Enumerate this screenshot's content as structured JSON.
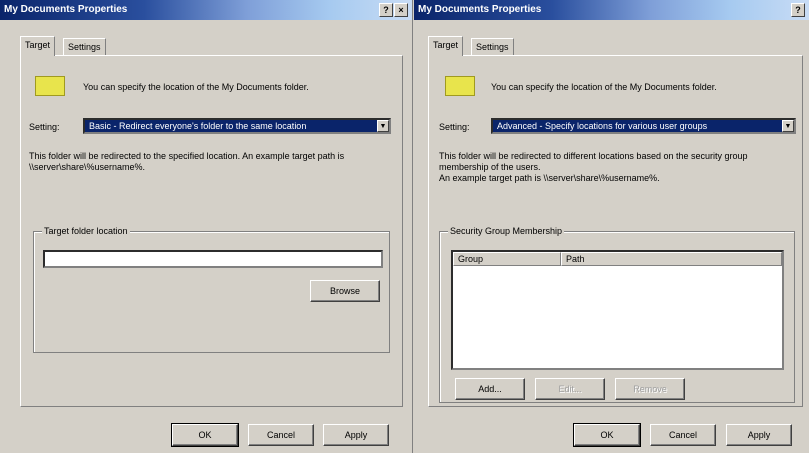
{
  "left_dialog": {
    "title": "My Documents Properties",
    "help_button": "?",
    "close_button": "×",
    "tabs": [
      "Target",
      "Settings"
    ],
    "info_text": "You can specify the location of the My Documents folder.",
    "setting_label": "Setting:",
    "setting_value": "Basic - Redirect everyone's folder to the same location",
    "description": "This folder will be redirected to the specified location. An example target path is \\\\server\\share\\%username%.",
    "group_label": "Target folder location",
    "target_path_value": "",
    "browse_button": "Browse",
    "ok_button": "OK",
    "cancel_button": "Cancel",
    "apply_button": "Apply"
  },
  "right_dialog": {
    "title": "My Documents Properties",
    "help_button": "?",
    "tabs": [
      "Target",
      "Settings"
    ],
    "info_text": "You can specify the location of the My Documents folder.",
    "setting_label": "Setting:",
    "setting_value": "Advanced - Specify locations for various user groups",
    "description": "This folder will be redirected to different locations based on the security group membership of the users.\nAn example target path is \\\\server\\share\\%username%.",
    "group_label": "Security Group Membership",
    "columns": [
      "Group",
      "Path"
    ],
    "rows": [],
    "add_button": "Add...",
    "edit_button": "Edit...",
    "remove_button": "Remove",
    "ok_button": "OK",
    "cancel_button": "Cancel",
    "apply_button": "Apply"
  },
  "colors": {
    "dialog_bg": "#d4d0c8",
    "titlebar_start": "#0a246a",
    "selection": "#0a246a",
    "folder_icon": "#e8e44c"
  }
}
